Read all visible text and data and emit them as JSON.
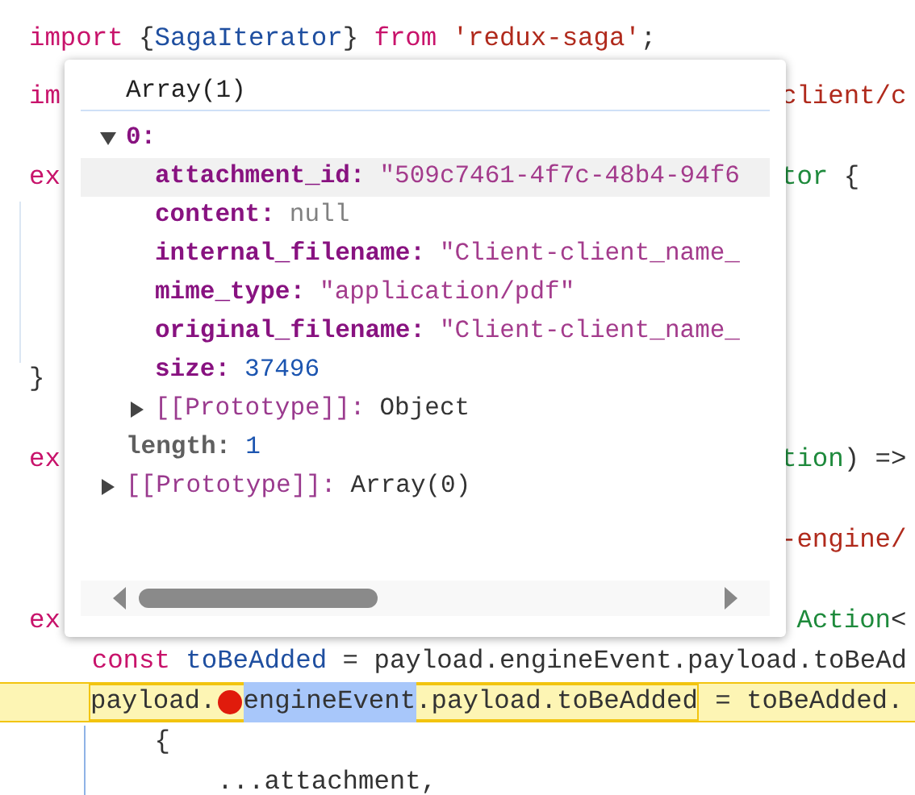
{
  "code": {
    "lines": [
      {
        "kind": "code",
        "segments": [
          {
            "text": "import",
            "kind": "kw"
          },
          {
            "text": " {",
            "kind": "plain"
          },
          {
            "text": "SagaIterator",
            "kind": "type"
          },
          {
            "text": "} ",
            "kind": "plain"
          },
          {
            "text": "from",
            "kind": "kw"
          },
          {
            "text": " 'redux-saga'",
            "kind": "str"
          },
          {
            "text": ";",
            "kind": "plain"
          }
        ]
      },
      {
        "kind": "covered",
        "left": [
          {
            "text": "im",
            "kind": "kw"
          }
        ],
        "right": [
          {
            "text": "client/c",
            "kind": "str"
          }
        ]
      },
      {
        "kind": "blank"
      },
      {
        "kind": "covered",
        "left": [
          {
            "text": "ex",
            "kind": "kw"
          }
        ],
        "right": [
          {
            "text": "tor",
            "kind": "green"
          },
          {
            "text": " {",
            "kind": "plain"
          }
        ]
      },
      {
        "kind": "blank"
      },
      {
        "kind": "blank"
      },
      {
        "kind": "blank"
      },
      {
        "kind": "blank"
      },
      {
        "kind": "code",
        "segments": [
          {
            "text": "}",
            "kind": "plain"
          }
        ]
      },
      {
        "kind": "blank"
      },
      {
        "kind": "covered",
        "left": [
          {
            "text": "ex",
            "kind": "kw"
          }
        ],
        "right": [
          {
            "text": "tion",
            "kind": "green"
          },
          {
            "text": ") =>",
            "kind": "plain"
          }
        ]
      },
      {
        "kind": "blank"
      },
      {
        "kind": "covered",
        "right": [
          {
            "text": "-engine/",
            "kind": "str"
          }
        ]
      },
      {
        "kind": "blank"
      },
      {
        "kind": "covered",
        "left": [
          {
            "text": "ex",
            "kind": "kw"
          }
        ],
        "right": [
          {
            "text": " Action",
            "kind": "green"
          },
          {
            "text": "<",
            "kind": "plain"
          }
        ]
      },
      {
        "kind": "code",
        "segments": [
          {
            "text": "    const",
            "kind": "kw"
          },
          {
            "text": " toBeAdded",
            "kind": "type"
          },
          {
            "text": " = payload.engineEvent.payload.toBeAd",
            "kind": "plain"
          }
        ]
      },
      {
        "kind": "paused",
        "expression": [
          {
            "text": "payload.",
            "kind": "plain"
          },
          {
            "kind": "breakpoint"
          },
          {
            "text": "engineEvent",
            "kind": "selected"
          },
          {
            "text": ".payload.toBeAdded",
            "kind": "plain"
          }
        ],
        "rest": [
          {
            "text": " = toBeAdded.",
            "kind": "plain"
          }
        ]
      },
      {
        "kind": "code",
        "segments": [
          {
            "text": "        {",
            "kind": "plain"
          }
        ]
      },
      {
        "kind": "code",
        "segments": [
          {
            "text": "            ...attachment,",
            "kind": "plain"
          }
        ]
      }
    ]
  },
  "popup": {
    "title": "Array(1)",
    "tree": [
      {
        "key": "0:",
        "kind": "index",
        "expanded": true,
        "hovered": false,
        "children": [
          {
            "key": "attachment_id:",
            "kind": "string",
            "value": "\"509c7461-4f7c-48b4-94f6",
            "hovered": true
          },
          {
            "key": "content:",
            "kind": "null",
            "value": "null",
            "hovered": false
          },
          {
            "key": "internal_filename:",
            "kind": "string",
            "value": "\"Client-client_name_",
            "hovered": false
          },
          {
            "key": "mime_type:",
            "kind": "string",
            "value": "\"application/pdf\"",
            "hovered": false
          },
          {
            "key": "original_filename:",
            "kind": "string",
            "value": "\"Client-client_name_",
            "hovered": false
          },
          {
            "key": "size:",
            "kind": "number",
            "value": "37496",
            "hovered": false
          },
          {
            "key": "[[Prototype]]:",
            "kind": "prototype",
            "value": "Object",
            "expanded": false,
            "hovered": false
          }
        ]
      },
      {
        "key": "length:",
        "kind": "length",
        "value": "1",
        "hovered": false
      },
      {
        "key": "[[Prototype]]:",
        "kind": "prototype",
        "value": "Array(0)",
        "expanded": false,
        "hovered": false
      }
    ]
  }
}
